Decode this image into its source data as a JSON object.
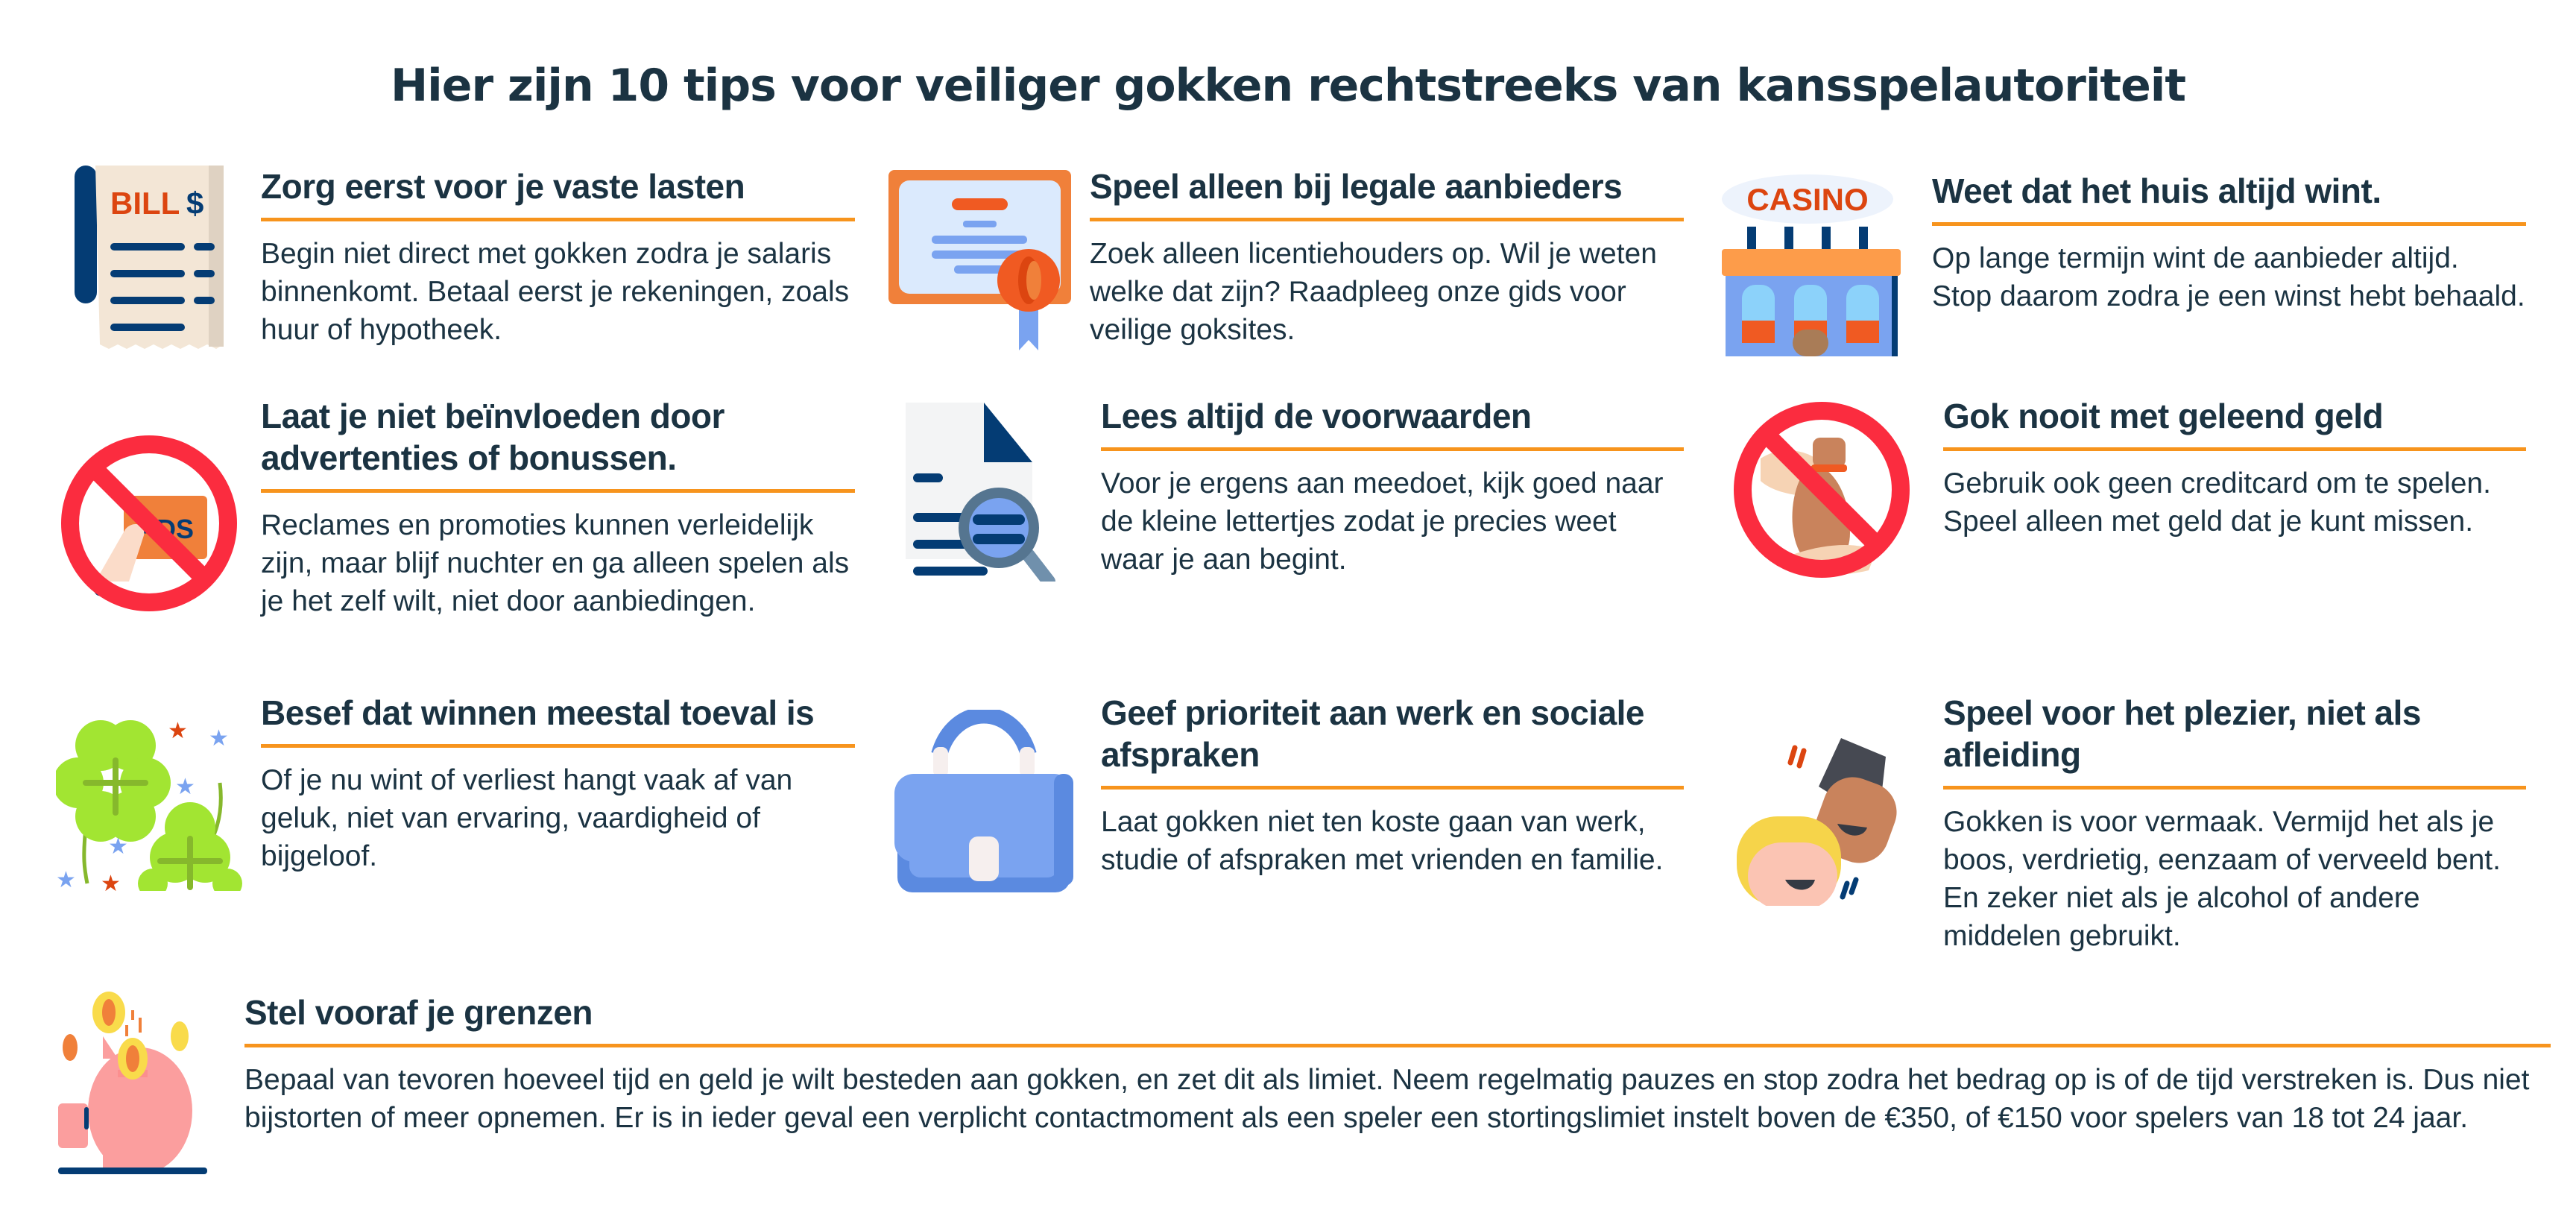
{
  "title": "Hier zijn 10 tips voor veiliger gokken rechtstreeks van kansspelautoriteit",
  "colors": {
    "heading": "#1b3342",
    "body": "#1b3342",
    "accent_rule": "#f7941d",
    "background": "#ffffff"
  },
  "tips": [
    {
      "icon": "bill-receipt-icon",
      "icon_labels": {
        "bill": "BILL",
        "currency": "$"
      },
      "heading": "Zorg eerst voor je vaste lasten",
      "body": "Begin niet direct met gokken zodra je salaris binnenkomt. Betaal eerst je rekeningen, zoals huur of hypotheek."
    },
    {
      "icon": "certificate-icon",
      "heading": "Speel alleen bij legale aanbieders",
      "body": "Zoek alleen licentiehouders op. Wil je weten welke dat zijn? Raadpleeg onze gids voor veilige goksites."
    },
    {
      "icon": "casino-building-icon",
      "icon_labels": {
        "sign": "CASINO"
      },
      "heading": "Weet dat het huis altijd wint.",
      "body": "Op lange termijn wint de aanbieder altijd. Stop daarom zodra je een winst hebt behaald."
    },
    {
      "icon": "no-ads-icon",
      "icon_labels": {
        "ads": "ADS"
      },
      "heading": "Laat je niet beïnvloeden door advertenties of bonussen.",
      "body": "Reclames en promoties kunnen verleidelijk zijn, maar blijf nuchter en ga alleen spelen als je het zelf wilt, niet door aanbiedingen."
    },
    {
      "icon": "document-search-icon",
      "heading": "Lees altijd de voorwaarden",
      "body": "Voor je ergens aan meedoet, kijk goed naar de kleine lettertjes zodat je precies weet waar je aan begint."
    },
    {
      "icon": "no-borrowed-money-icon",
      "heading": "Gok nooit met geleend geld",
      "body": "Gebruik ook geen creditcard om te spelen. Speel alleen met geld dat je kunt missen."
    },
    {
      "icon": "four-leaf-clover-icon",
      "heading": "Besef dat winnen meestal toeval is",
      "body": "Of je nu wint of verliest hangt vaak af van geluk, niet van ervaring, vaardigheid of bijgeloof."
    },
    {
      "icon": "briefcase-icon",
      "heading": "Geef prioriteit aan werk en sociale afspraken",
      "body": "Laat gokken niet ten koste gaan van werk, studie of afspraken met vrienden en familie."
    },
    {
      "icon": "laughing-friends-icon",
      "heading": "Speel voor het plezier, niet als afleiding",
      "body": "Gokken is voor vermaak. Vermijd het als je boos, verdrietig, eenzaam of verveeld bent. En zeker niet als je alcohol of andere middelen gebruikt."
    },
    {
      "icon": "piggy-bank-icon",
      "heading": "Stel vooraf je grenzen",
      "body": "Bepaal van tevoren hoeveel tijd en geld je wilt besteden aan gokken, en zet dit als limiet. Neem regelmatig pauzes en stop zodra het bedrag op is of de tijd verstreken is. Dus niet bijstorten of meer opnemen. Er is in ieder geval een verplicht contactmoment als een speler een stortingslimiet instelt boven de €350, of €150 voor spelers van 18 tot 24 jaar."
    }
  ]
}
